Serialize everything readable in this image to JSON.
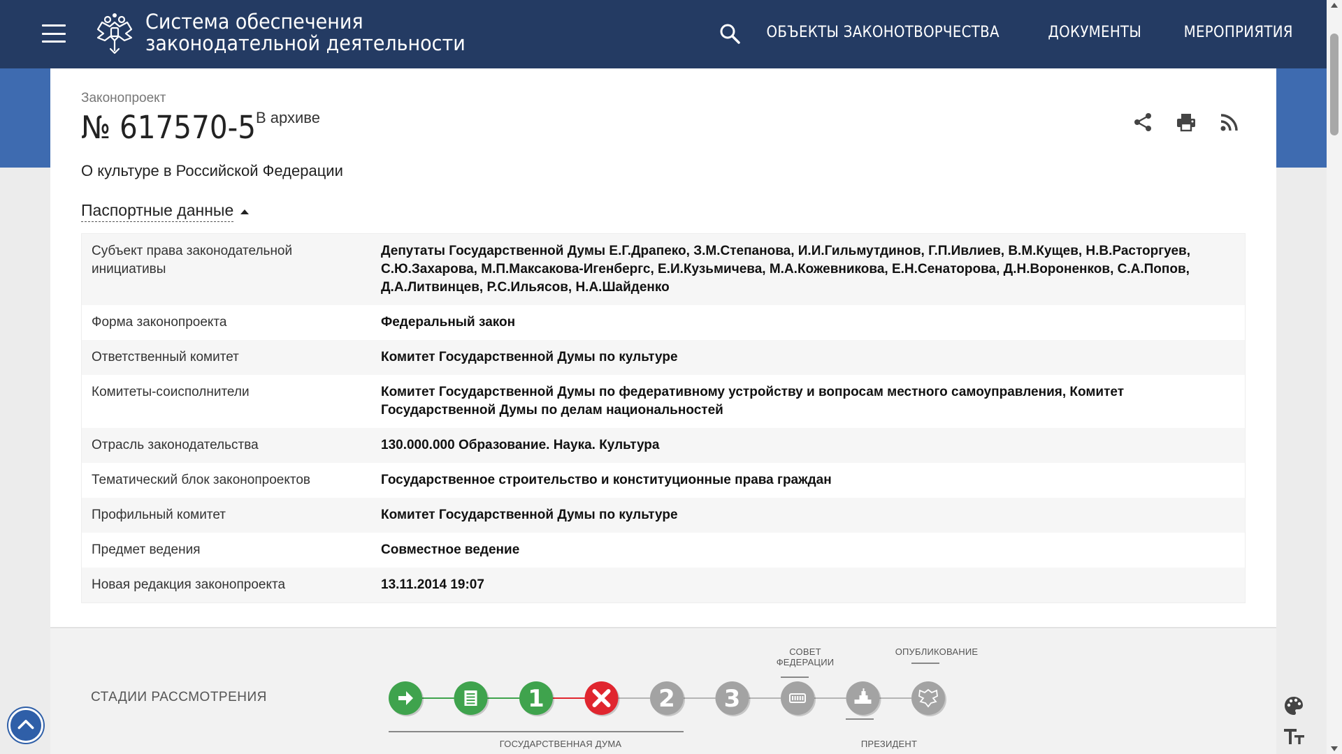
{
  "header": {
    "title_line1": "Система обеспечения",
    "title_line2": "законодательной деятельности",
    "nav": [
      "ОБЪЕКТЫ ЗАКОНОТВОРЧЕСТВА",
      "ДОКУМЕНТЫ",
      "МЕРОПРИЯТИЯ"
    ]
  },
  "bill": {
    "kicker": "Законопроект",
    "number": "№ 617570-5",
    "status": "В архиве",
    "title": "О культуре в Российской Федерации"
  },
  "passport": {
    "toggle_label": "Паспортные данные",
    "rows": [
      {
        "label": "Субъект права законодательной инициативы",
        "value": "Депутаты Государственной Думы Е.Г.Драпеко, З.М.Степанова, И.И.Гильмутдинов, Г.П.Ивлиев, В.М.Кущев, Н.В.Расторгуев, С.Ю.Захарова, М.П.Максакова-Игенбергс, Е.И.Кузьмичева, М.А.Кожевникова, Е.Н.Сенаторова, Д.Н.Вороненков, С.А.Попов, Д.А.Литвинцев, Р.С.Ильясов, Н.А.Шайденко"
      },
      {
        "label": "Форма законопроекта",
        "value": "Федеральный закон"
      },
      {
        "label": "Ответственный комитет",
        "value": "Комитет Государственной Думы по культуре"
      },
      {
        "label": "Комитеты-соисполнители",
        "value": "Комитет Государственной Думы по федеративному устройству и вопросам местного самоуправления, Комитет Государственной Думы по делам национальностей"
      },
      {
        "label": "Отрасль законодательства",
        "value": "130.000.000 Образование. Наука. Культура"
      },
      {
        "label": "Тематический блок законопроектов",
        "value": "Государственное строительство и конституционные права граждан"
      },
      {
        "label": "Профильный комитет",
        "value": "Комитет Государственной Думы по культуре"
      },
      {
        "label": "Предмет ведения",
        "value": "Совместное ведение"
      },
      {
        "label": "Новая редакция законопроекта",
        "value": "13.11.2014 19:07"
      }
    ]
  },
  "stages": {
    "title": "СТАДИИ РАССМОТРЕНИЯ",
    "label_duma": "ГОСУДАРСТВЕННАЯ ДУМА",
    "label_council_line1": "СОВЕТ",
    "label_council_line2": "ФЕДЕРАЦИИ",
    "label_president": "ПРЕЗИДЕНТ",
    "label_published": "ОПУБЛИКОВАНИЕ",
    "items": [
      {
        "kind": "arrow",
        "state": "done",
        "color": "#3fa34d"
      },
      {
        "kind": "document",
        "state": "done",
        "color": "#3fa34d"
      },
      {
        "kind": "number",
        "text": "1",
        "state": "done",
        "color": "#3fa34d"
      },
      {
        "kind": "cross",
        "state": "rejected",
        "color": "#e0262f"
      },
      {
        "kind": "number",
        "text": "2",
        "state": "inactive",
        "color": "#a3a3a3"
      },
      {
        "kind": "number",
        "text": "3",
        "state": "inactive",
        "color": "#a3a3a3"
      },
      {
        "kind": "council",
        "state": "inactive",
        "color": "#a3a3a3"
      },
      {
        "kind": "president",
        "state": "inactive",
        "color": "#a3a3a3"
      },
      {
        "kind": "emblem",
        "state": "inactive",
        "color": "#a3a3a3"
      }
    ]
  },
  "colors": {
    "header_bg": "#243b63",
    "band_bg": "#3e6bb0",
    "green": "#3fa34d",
    "red": "#e0262f",
    "gray": "#a3a3a3"
  }
}
